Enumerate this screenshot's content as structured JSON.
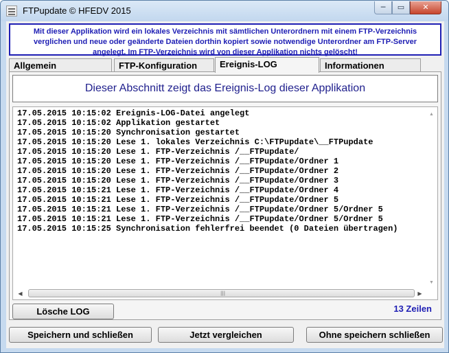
{
  "window": {
    "title": "FTPupdate © HFEDV 2015",
    "min_glyph": "─",
    "max_glyph": "▭",
    "close_glyph": "✕"
  },
  "info": {
    "line1": "Mit dieser Applikation wird ein lokales Verzeichnis mit sämtlichen Unterordnern mit einem FTP-Verzeichnis",
    "line2": "verglichen und neue oder geänderte Dateien dorthin kopiert sowie notwendige Unterordner am FTP-Server",
    "line3": "angelegt. Im FTP-Verzeichnis wird von dieser Applikation nichts gelöscht!"
  },
  "tabs": [
    {
      "label": "Allgemein"
    },
    {
      "label": "FTP-Konfiguration"
    },
    {
      "label": "Ereignis-LOG"
    },
    {
      "label": "Informationen"
    }
  ],
  "banner": "Dieser Abschnitt zeigt das Ereignis-Log dieser Applikation",
  "log": [
    "17.05.2015 10:15:02 Ereignis-LOG-Datei angelegt",
    "17.05.2015 10:15:02 Applikation gestartet",
    "17.05.2015 10:15:20 Synchronisation gestartet",
    "17.05.2015 10:15:20 Lese 1. lokales Verzeichnis C:\\FTPupdate\\__FTPupdate",
    "17.05.2015 10:15:20 Lese 1. FTP-Verzeichnis /__FTPupdate/",
    "17.05.2015 10:15:20 Lese 1. FTP-Verzeichnis /__FTPupdate/Ordner 1",
    "17.05.2015 10:15:20 Lese 1. FTP-Verzeichnis /__FTPupdate/Ordner 2",
    "17.05.2015 10:15:20 Lese 1. FTP-Verzeichnis /__FTPupdate/Ordner 3",
    "17.05.2015 10:15:21 Lese 1. FTP-Verzeichnis /__FTPupdate/Ordner 4",
    "17.05.2015 10:15:21 Lese 1. FTP-Verzeichnis /__FTPupdate/Ordner 5",
    "17.05.2015 10:15:21 Lese 1. FTP-Verzeichnis /__FTPupdate/Ordner 5/Ordner 5",
    "17.05.2015 10:15:21 Lese 1. FTP-Verzeichnis /__FTPupdate/Ordner 5/Ordner 5",
    "17.05.2015 10:15:25 Synchronisation fehlerfrei beendet (0 Dateien übertragen)"
  ],
  "scroll": {
    "up": "▲",
    "down": "▼",
    "left": "◀",
    "right": "▶",
    "grip": "|||"
  },
  "buttons": {
    "clear_log": "Lösche LOG",
    "save_close": "Speichern und schließen",
    "compare_now": "Jetzt vergleichen",
    "close_no_save": "Ohne speichern schließen"
  },
  "line_count": "13 Zeilen"
}
